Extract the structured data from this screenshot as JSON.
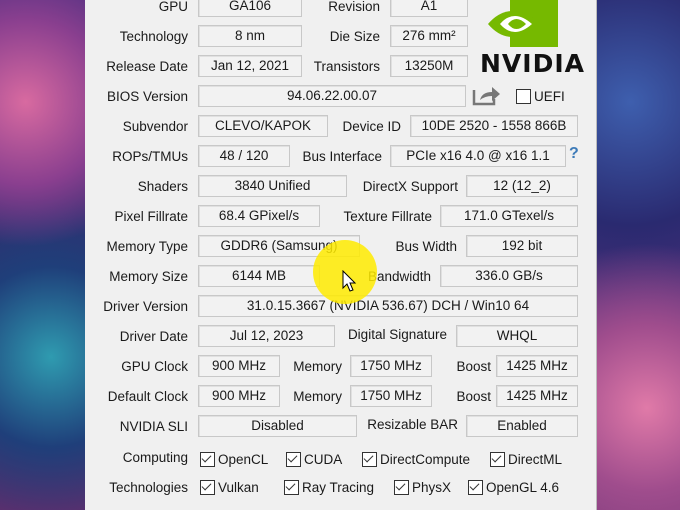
{
  "vendor": {
    "logo_text": "NVIDIA",
    "brand_color": "#76b900"
  },
  "rows": {
    "gpu": {
      "label": "GPU",
      "value": "GA106",
      "label2": "Revision",
      "value2": "A1"
    },
    "technology": {
      "label": "Technology",
      "value": "8 nm",
      "label2": "Die Size",
      "value2": "276 mm²"
    },
    "release": {
      "label": "Release Date",
      "value": "Jan 12, 2021",
      "label2": "Transistors",
      "value2": "13250M"
    },
    "bios": {
      "label": "BIOS Version",
      "value": "94.06.22.00.07",
      "uefi_label": "UEFI",
      "uefi_checked": false
    },
    "subvendor": {
      "label": "Subvendor",
      "value": "CLEVO/KAPOK",
      "label2": "Device ID",
      "value2": "10DE 2520 - 1558 866B"
    },
    "rops": {
      "label": "ROPs/TMUs",
      "value": "48 / 120",
      "label2": "Bus Interface",
      "value2": "PCIe x16 4.0 @ x16 1.1",
      "help": "?"
    },
    "shaders": {
      "label": "Shaders",
      "value": "3840 Unified",
      "label2": "DirectX Support",
      "value2": "12 (12_2)"
    },
    "fillrate": {
      "label": "Pixel Fillrate",
      "value": "68.4 GPixel/s",
      "label2": "Texture Fillrate",
      "value2": "171.0 GTexel/s"
    },
    "memtype": {
      "label": "Memory Type",
      "value": "GDDR6 (Samsung)",
      "label2": "Bus Width",
      "value2": "192 bit"
    },
    "memsize": {
      "label": "Memory Size",
      "value": "6144 MB",
      "label2": "Bandwidth",
      "value2": "336.0 GB/s"
    },
    "driver": {
      "label": "Driver Version",
      "value": "31.0.15.3667 (NVIDIA 536.67) DCH / Win10 64"
    },
    "driverdate": {
      "label": "Driver Date",
      "value": "Jul 12, 2023",
      "label2": "Digital Signature",
      "value2": "WHQL"
    },
    "gpuclock": {
      "label": "GPU Clock",
      "value": "900 MHz",
      "label2": "Memory",
      "value2": "1750 MHz",
      "label3": "Boost",
      "value3": "1425 MHz"
    },
    "defclock": {
      "label": "Default Clock",
      "value": "900 MHz",
      "label2": "Memory",
      "value2": "1750 MHz",
      "label3": "Boost",
      "value3": "1425 MHz"
    },
    "sli": {
      "label": "NVIDIA SLI",
      "value": "Disabled",
      "label2": "Resizable BAR",
      "value2": "Enabled"
    }
  },
  "computing": {
    "label": "Computing",
    "items": [
      "OpenCL",
      "CUDA",
      "DirectCompute",
      "DirectML"
    ]
  },
  "technologies": {
    "label": "Technologies",
    "items": [
      "Vulkan",
      "Ray Tracing",
      "PhysX",
      "OpenGL 4.6"
    ]
  }
}
